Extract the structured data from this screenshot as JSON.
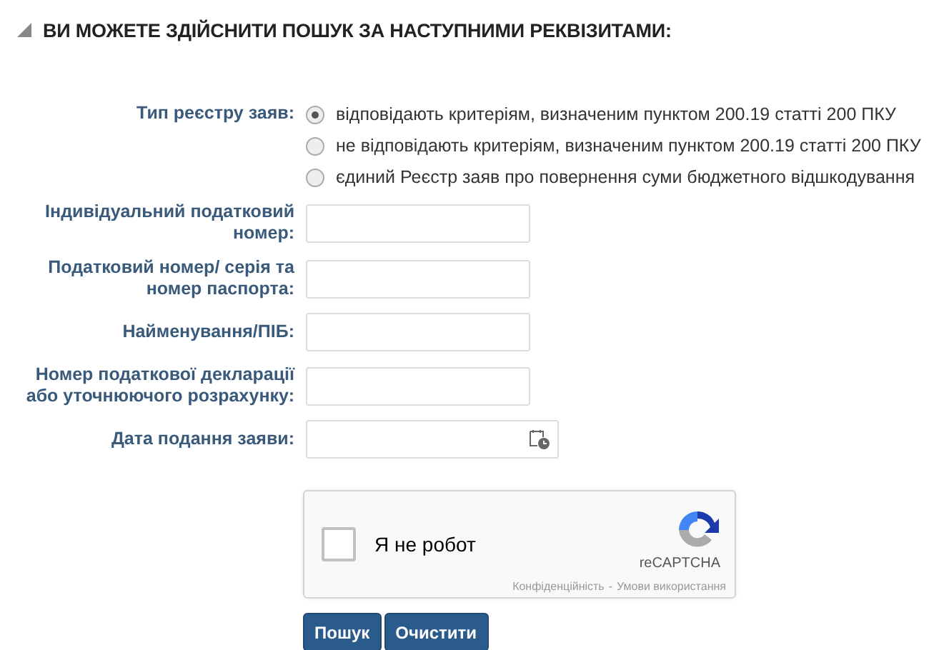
{
  "section": {
    "title": "ВИ МОЖЕТЕ ЗДІЙСНИТИ ПОШУК ЗА НАСТУПНИМИ РЕКВІЗИТАМИ:",
    "expanded": true
  },
  "register_type": {
    "label": "Тип реєстру заяв:",
    "options": [
      {
        "label": "відповідають критеріям, визначеним пунктом 200.19 статті 200 ПКУ",
        "selected": true
      },
      {
        "label": "не відповідають критеріям, визначеним пунктом 200.19 статті 200 ПКУ",
        "selected": false
      },
      {
        "label": "єдиний Реєстр заяв про повернення суми бюджетного відшкодування",
        "selected": false
      }
    ]
  },
  "fields": [
    {
      "kind": "text",
      "label": "Індивідуальний податковий номер:"
    },
    {
      "kind": "text",
      "label": "Податковий номер/ серія та номер паспорта:"
    },
    {
      "kind": "text",
      "label": "Найменування/ПІБ:"
    },
    {
      "kind": "text",
      "label": "Номер податкової декларації або уточнюючого розрахунку:"
    },
    {
      "kind": "date",
      "label": "Дата подання заяви:"
    }
  ],
  "captcha": {
    "label": "Я не робот",
    "checked": false,
    "brand": "reCAPTCHA",
    "links": [
      "Конфіденційність",
      "Умови використання"
    ],
    "separator": "-"
  },
  "buttons": [
    "Пошук",
    "Очистити"
  ]
}
